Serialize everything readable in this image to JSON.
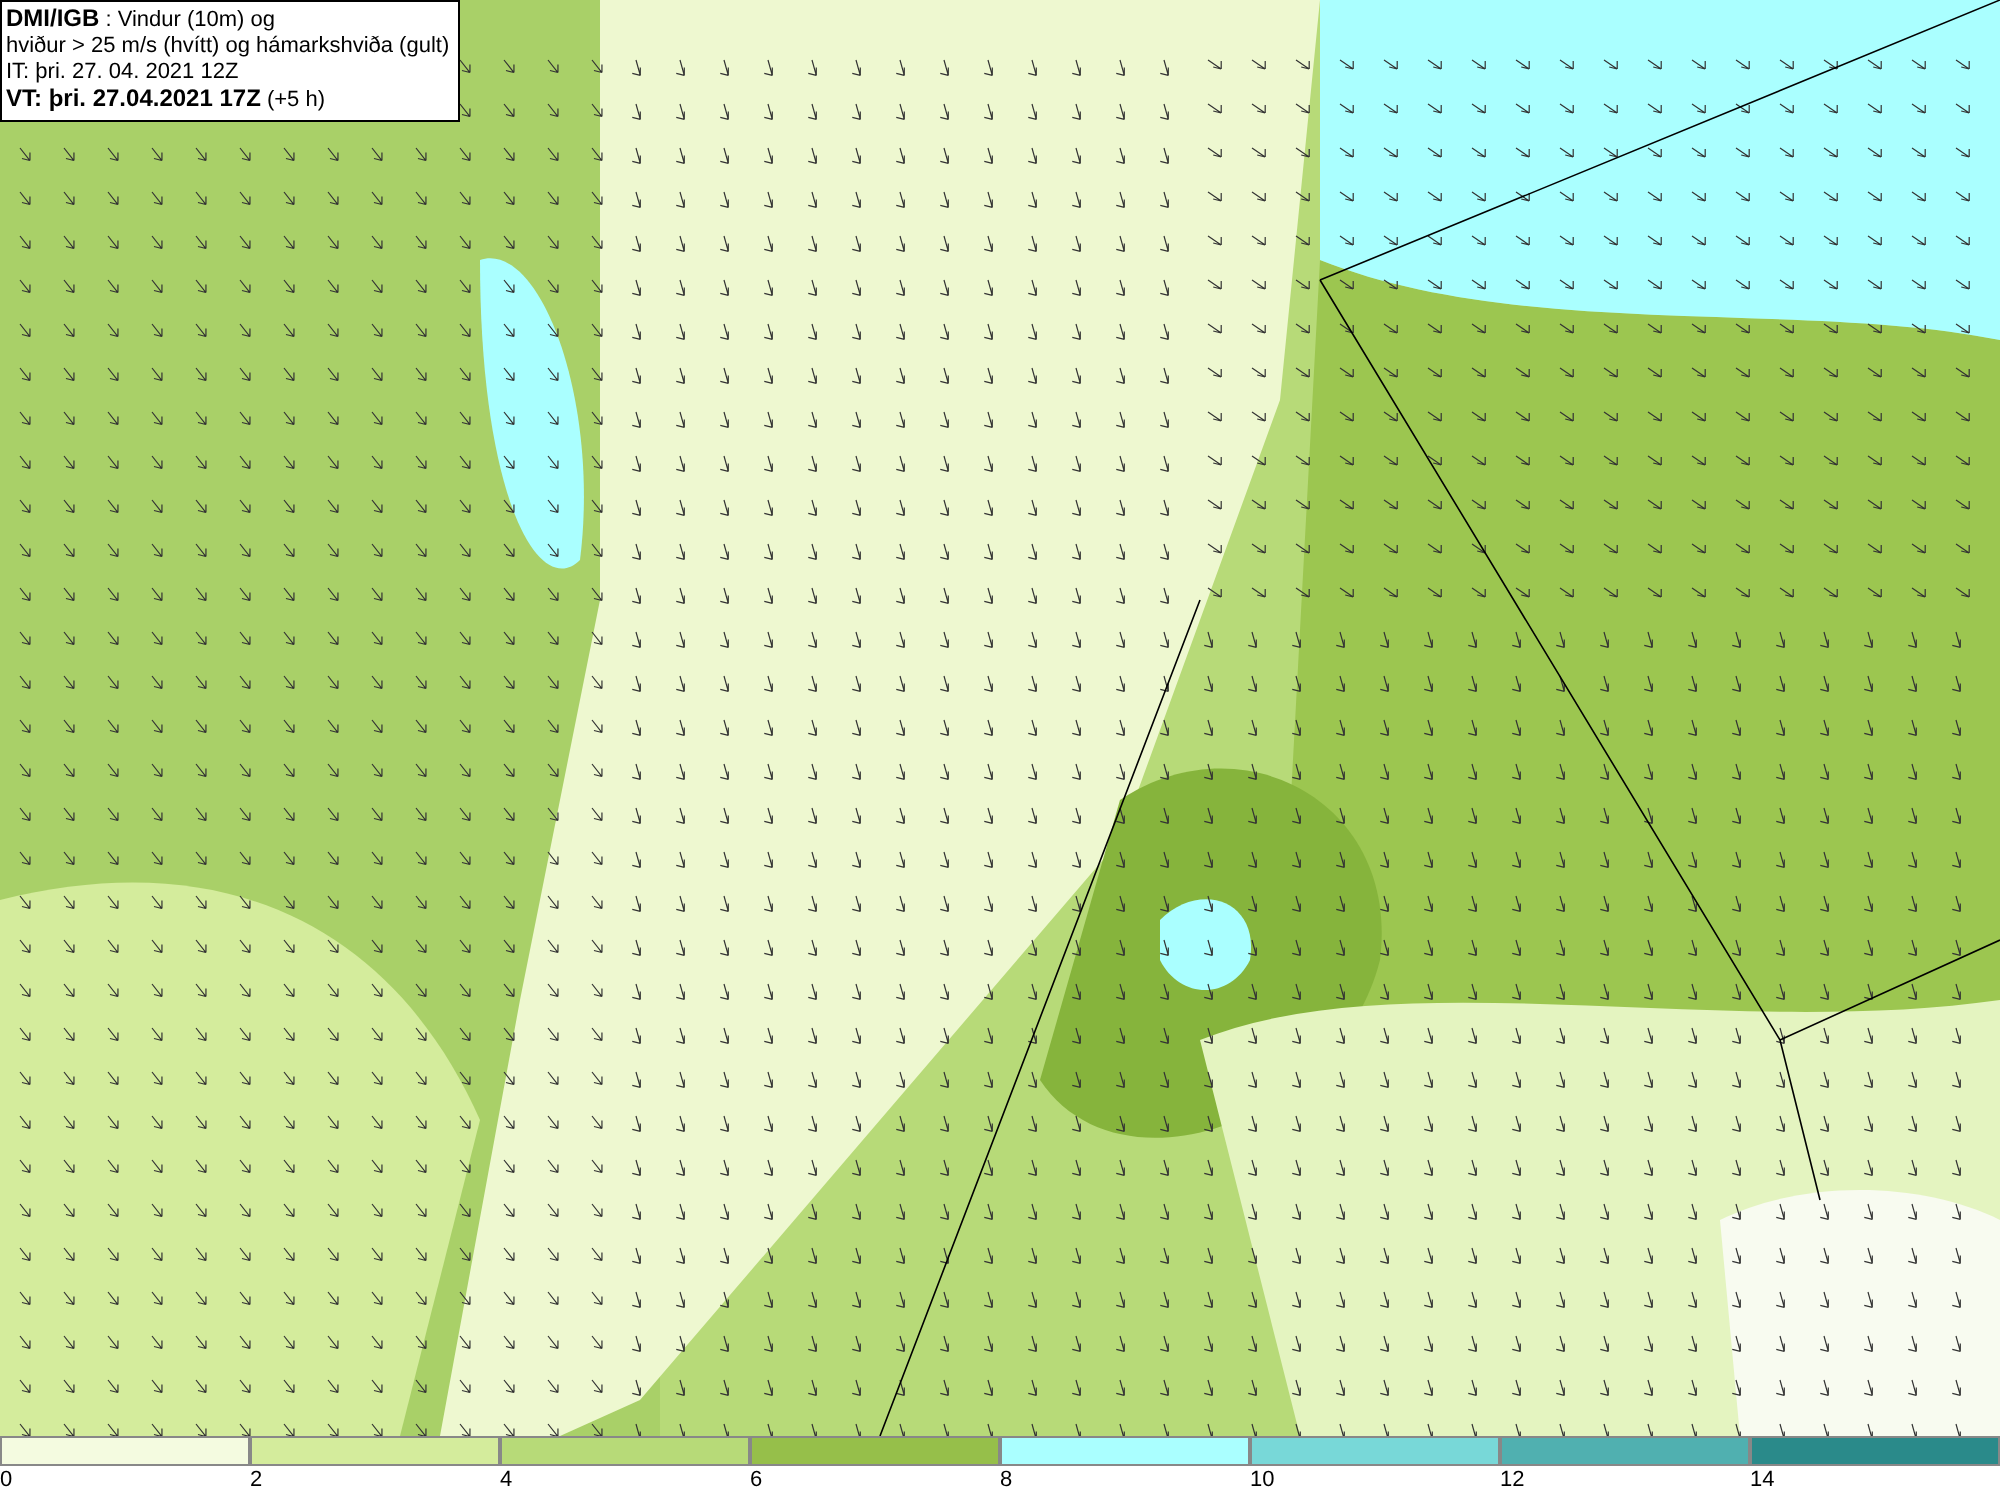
{
  "header": {
    "lines": [
      "**DMI/IGB** : Vindur (10m) og",
      "hviður > 25 m/s (hvítt) og hámarkshviða (gult)",
      "IT: þri. 27. 04. 2021 12Z",
      "**VT: þri. 27.04.2021 17Z** (+5 h)"
    ]
  },
  "legend": {
    "bins": [
      {
        "color": "#f4fbe0",
        "label": "0"
      },
      {
        "color": "#d4ec9c",
        "label": "2"
      },
      {
        "color": "#b7da78",
        "label": "4"
      },
      {
        "color": "#96bf4a",
        "label": "6"
      },
      {
        "color": "#aaffff",
        "label": "8"
      },
      {
        "color": "#78d8d8",
        "label": "10"
      },
      {
        "color": "#50b0b0",
        "label": "12"
      },
      {
        "color": "#2a8a8a",
        "label": "14"
      }
    ]
  }
}
